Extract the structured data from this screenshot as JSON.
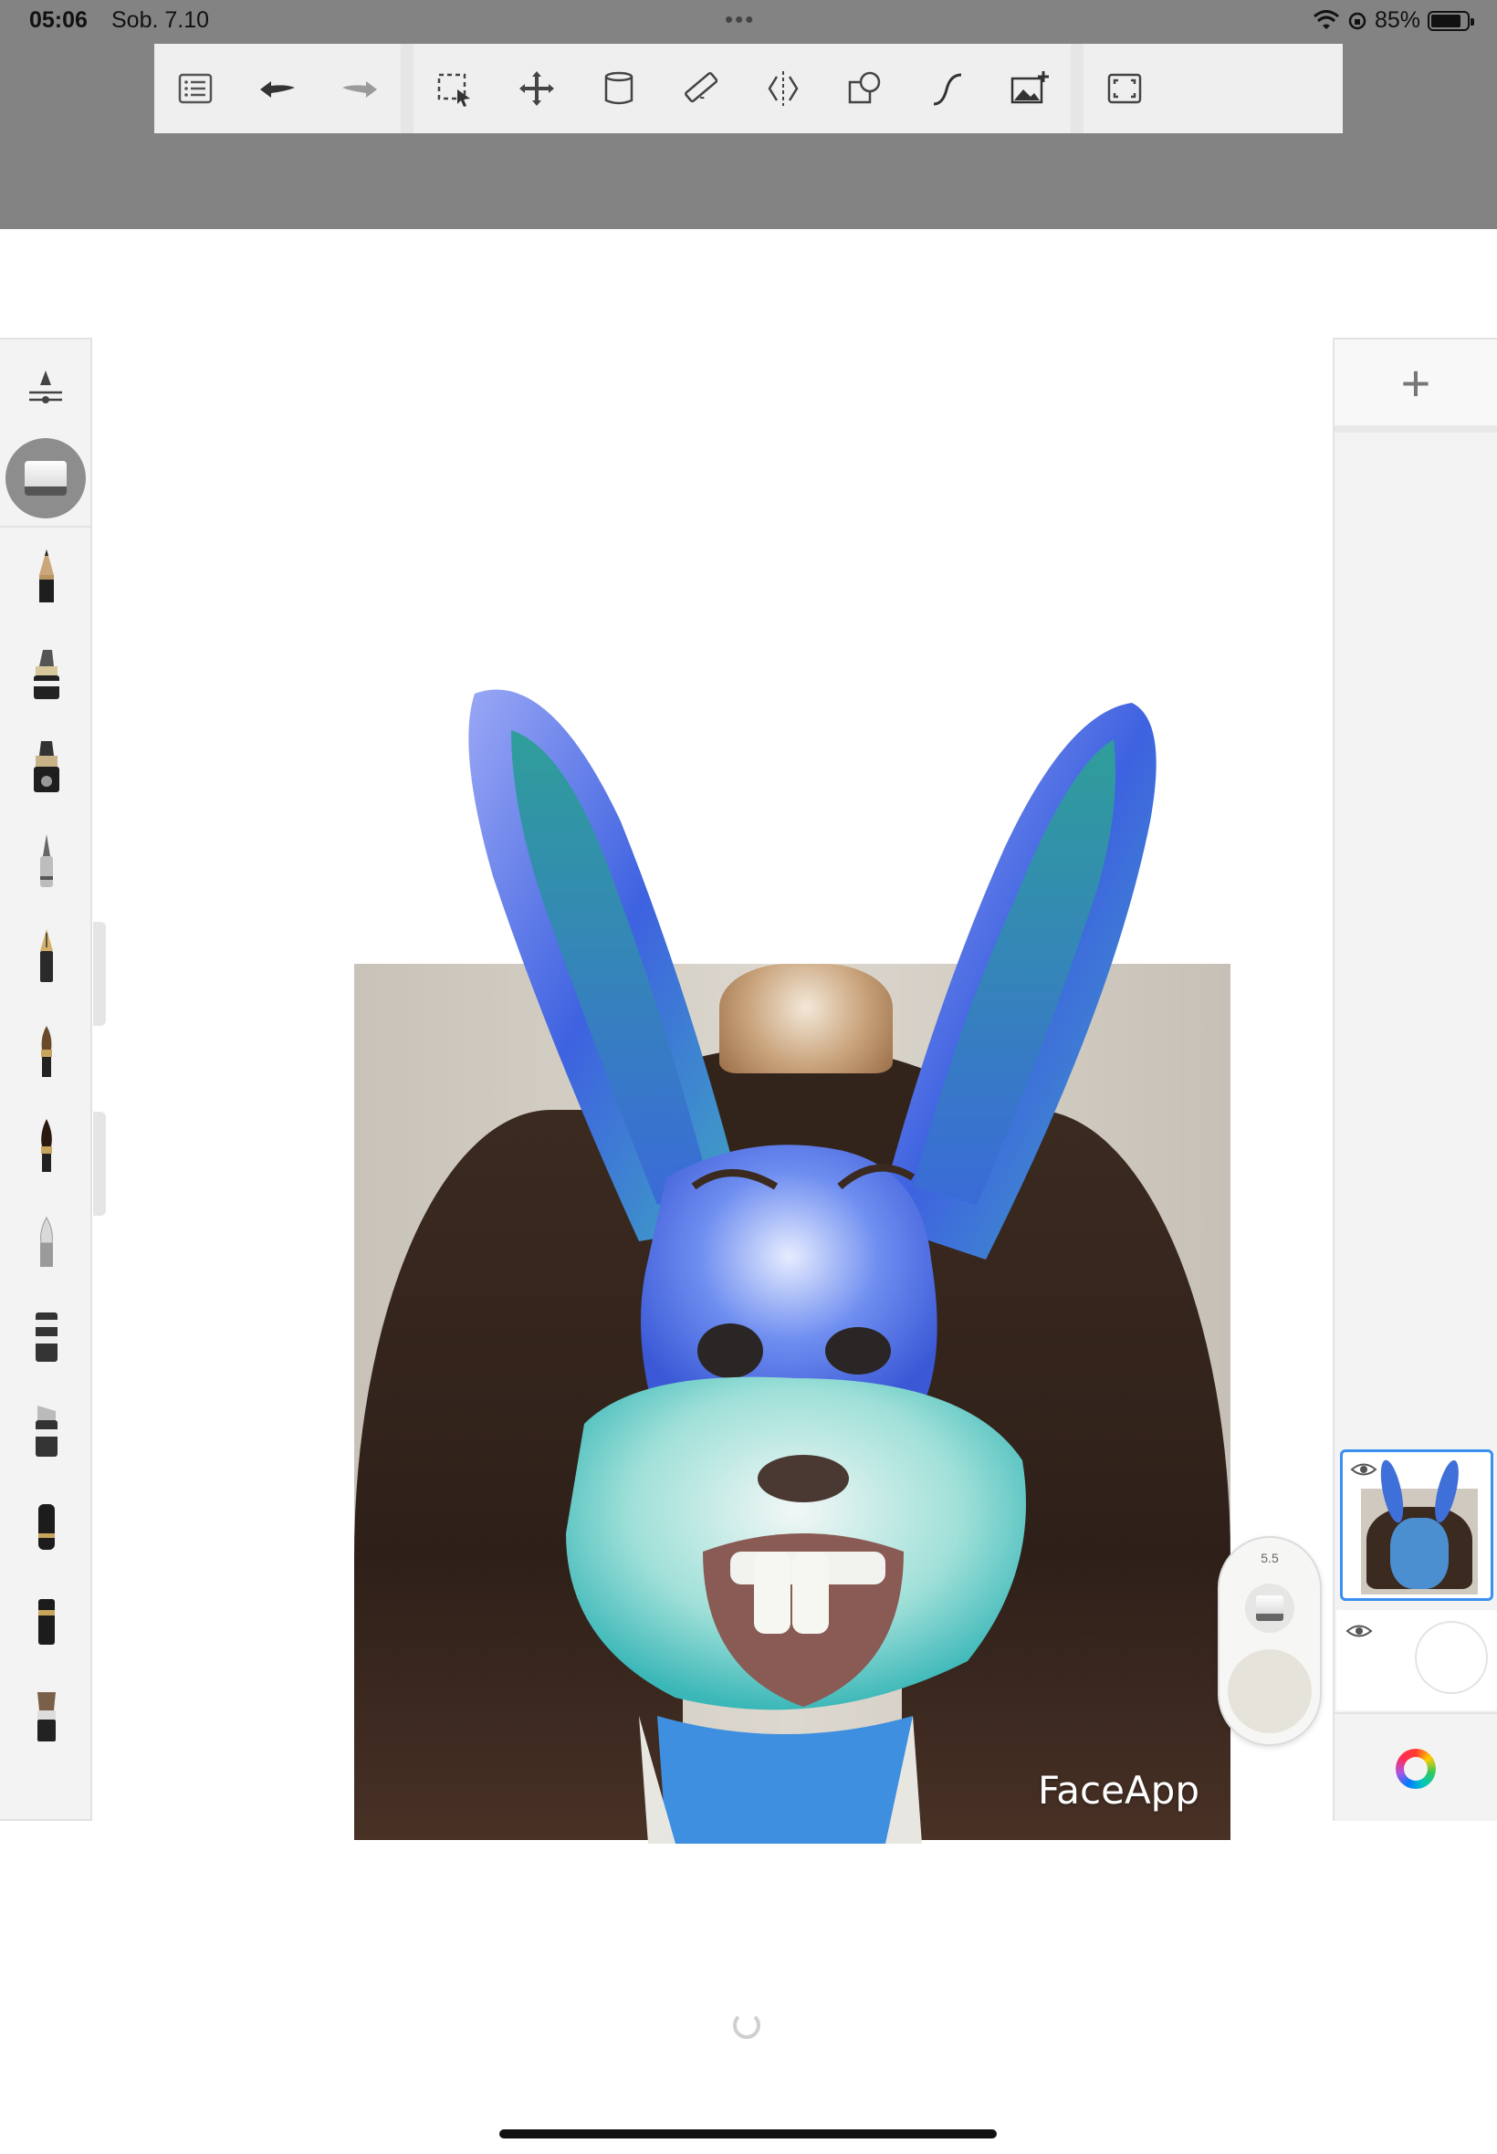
{
  "status_bar": {
    "time": "05:06",
    "date": "Sob. 7.10",
    "battery": "85%",
    "battery_level": 0.85
  },
  "toolbar": {
    "items": [
      {
        "name": "menu-list",
        "icon": "list-icon"
      },
      {
        "name": "undo",
        "icon": "undo-arrow-icon"
      },
      {
        "name": "redo",
        "icon": "redo-arrow-icon"
      },
      {
        "name": "selection",
        "icon": "selection-icon"
      },
      {
        "name": "transform",
        "icon": "move-arrows-icon"
      },
      {
        "name": "fill",
        "icon": "bucket-icon"
      },
      {
        "name": "ruler",
        "icon": "ruler-icon"
      },
      {
        "name": "symmetry",
        "icon": "symmetry-icon"
      },
      {
        "name": "shapes",
        "icon": "shapes-icon"
      },
      {
        "name": "stroke",
        "icon": "curve-icon"
      },
      {
        "name": "import-image",
        "icon": "add-image-icon"
      },
      {
        "name": "fullscreen",
        "icon": "fullscreen-icon"
      }
    ]
  },
  "brush_panel": {
    "active_tool": "eraser",
    "brushes": [
      "pencil",
      "marker-chisel",
      "marker-fat",
      "technical-pen",
      "fountain-pen",
      "paint-brush",
      "ink-brush",
      "soft-airbrush",
      "cartridge-marker",
      "marker-wide",
      "pen-felt",
      "pen-block",
      "bristle-brush"
    ]
  },
  "puck": {
    "size": "5.5",
    "color": "#e6e3da"
  },
  "layers_panel": {
    "add_label": "+",
    "layers": [
      {
        "name": "photo-layer",
        "visible": true,
        "selected": true
      },
      {
        "name": "background-layer",
        "visible": true,
        "selected": false
      }
    ]
  },
  "canvas": {
    "watermark": "FaceApp"
  },
  "colors": {
    "accent": "#3b8ff0",
    "toolbar_bg": "#efefef",
    "top_region": "#838383"
  }
}
